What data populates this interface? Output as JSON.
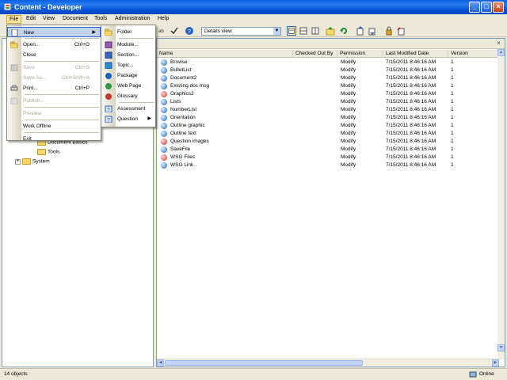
{
  "window": {
    "title": "Content - Developer"
  },
  "menubar": [
    "File",
    "Edit",
    "View",
    "Document",
    "Tools",
    "Administration",
    "Help"
  ],
  "toolbar": {
    "views_value": "Details view"
  },
  "file_menu": [
    {
      "label": "New",
      "shortcut": "",
      "submenu": true,
      "disabled": false,
      "highlight": true
    },
    {
      "sep": true
    },
    {
      "label": "Open...",
      "shortcut": "Ctrl+O",
      "disabled": false
    },
    {
      "label": "Close",
      "shortcut": "",
      "disabled": false
    },
    {
      "sep": true
    },
    {
      "label": "Save",
      "shortcut": "Ctrl+S",
      "disabled": true
    },
    {
      "label": "Save As...",
      "shortcut": "Ctrl+Shift+A",
      "disabled": true
    },
    {
      "label": "Print...",
      "shortcut": "Ctrl+P",
      "disabled": false
    },
    {
      "sep": true
    },
    {
      "label": "Publish...",
      "shortcut": "",
      "disabled": true
    },
    {
      "sep": true
    },
    {
      "label": "Preview",
      "shortcut": "",
      "disabled": true
    },
    {
      "sep": true
    },
    {
      "label": "Work Offline",
      "shortcut": "",
      "disabled": false
    },
    {
      "sep": true
    },
    {
      "label": "Exit",
      "shortcut": "",
      "disabled": false
    }
  ],
  "new_menu": [
    {
      "label": "Folder",
      "icon": "folder-icon"
    },
    {
      "sep": true
    },
    {
      "label": "Module...",
      "icon": "module-icon"
    },
    {
      "label": "Section...",
      "icon": "section-icon"
    },
    {
      "label": "Topic...",
      "icon": "topic-icon"
    },
    {
      "label": "Package",
      "icon": "package-icon"
    },
    {
      "label": "Web Page",
      "icon": "web-page-icon"
    },
    {
      "label": "Glossary",
      "icon": "glossary-icon"
    },
    {
      "sep": true
    },
    {
      "label": "Assessment",
      "icon": "assessment-icon"
    },
    {
      "label": "Question",
      "icon": "question-icon",
      "submenu": true
    }
  ],
  "tree": [
    {
      "label": "Document Basics",
      "indent": 2
    },
    {
      "label": "Tools",
      "indent": 2
    },
    {
      "label": "System",
      "indent": 1,
      "expander": "+"
    }
  ],
  "columns": [
    "Name",
    "Checked Out By",
    "Permission",
    "Last Modified Date",
    "Version"
  ],
  "rows": [
    {
      "name": "Browse",
      "perm": "Modify",
      "date": "7/15/2011 8:46:16 AM",
      "ver": "1",
      "kind": "globe"
    },
    {
      "name": "BulletList",
      "perm": "Modify",
      "date": "7/15/2011 8:46:16 AM",
      "ver": "1",
      "kind": "globe"
    },
    {
      "name": "Document2",
      "perm": "Modify",
      "date": "7/15/2011 8:46:16 AM",
      "ver": "1",
      "kind": "globe"
    },
    {
      "name": "Existing doc msg",
      "perm": "Modify",
      "date": "7/15/2011 8:46:16 AM",
      "ver": "1",
      "kind": "globe"
    },
    {
      "name": "Graphics2",
      "perm": "Modify",
      "date": "7/15/2011 8:46:16 AM",
      "ver": "1",
      "kind": "image"
    },
    {
      "name": "Lists",
      "perm": "Modify",
      "date": "7/15/2011 8:46:16 AM",
      "ver": "1",
      "kind": "globe"
    },
    {
      "name": "NumberList",
      "perm": "Modify",
      "date": "7/15/2011 8:46:16 AM",
      "ver": "1",
      "kind": "globe"
    },
    {
      "name": "Orientation",
      "perm": "Modify",
      "date": "7/15/2011 8:46:16 AM",
      "ver": "1",
      "kind": "globe"
    },
    {
      "name": "Outline graphic",
      "perm": "Modify",
      "date": "7/15/2011 8:46:16 AM",
      "ver": "1",
      "kind": "globe"
    },
    {
      "name": "Outline text",
      "perm": "Modify",
      "date": "7/15/2011 8:46:16 AM",
      "ver": "1",
      "kind": "globe"
    },
    {
      "name": "Question images",
      "perm": "Modify",
      "date": "7/15/2011 8:46:16 AM",
      "ver": "1",
      "kind": "image"
    },
    {
      "name": "SaveFile",
      "perm": "Modify",
      "date": "7/15/2011 8:46:16 AM",
      "ver": "1",
      "kind": "globe"
    },
    {
      "name": "WSG Files",
      "perm": "Modify",
      "date": "7/15/2011 8:46:16 AM",
      "ver": "1",
      "kind": "image"
    },
    {
      "name": "WSG Link",
      "perm": "Modify",
      "date": "7/15/2011 8:46:16 AM",
      "ver": "1",
      "kind": "globe"
    }
  ],
  "status": {
    "count": "14 objects",
    "online": "Online"
  }
}
